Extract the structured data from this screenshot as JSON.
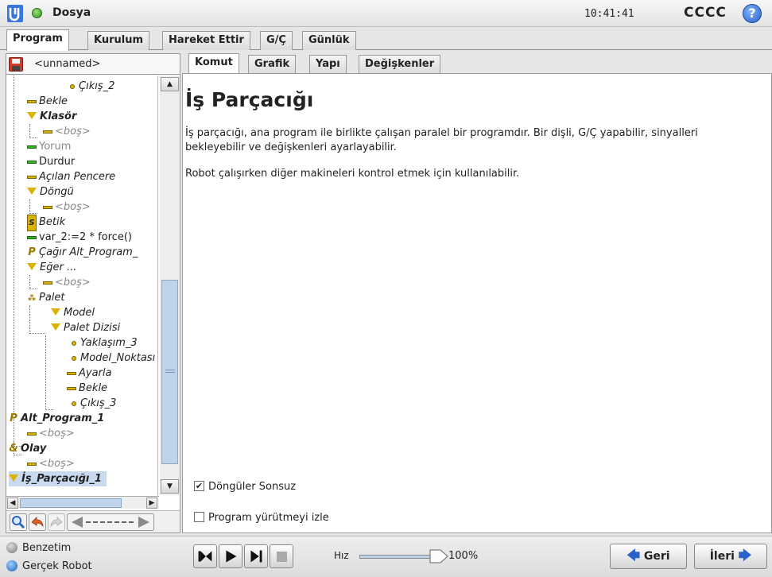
{
  "header": {
    "app_title": "Dosya",
    "clock": "10:41:41",
    "robot_name": "CCCC",
    "help_glyph": "?"
  },
  "main_tabs": [
    "Program",
    "Kurulum",
    "Hareket Ettir",
    "G/Ç",
    "Günlük"
  ],
  "active_main_tab": "Program",
  "file": {
    "name": "<unnamed>"
  },
  "tree": [
    {
      "label": "Çıkış_2",
      "icon": "waypoint-dot-icon",
      "style": "italic"
    },
    {
      "label": "Bekle",
      "icon": "command-bar-icon",
      "style": "italic"
    },
    {
      "label": "Klasör",
      "icon": "folder-triangle-icon",
      "style": "bold-italic"
    },
    {
      "label": "<boş>",
      "icon": "command-bar-icon",
      "style": "grey"
    },
    {
      "label": "Yorum",
      "icon": "comment-bar-icon",
      "style": "muted"
    },
    {
      "label": "Durdur",
      "icon": "halt-bar-icon",
      "style": "normal"
    },
    {
      "label": "Açılan Pencere",
      "icon": "command-bar-icon",
      "style": "italic"
    },
    {
      "label": "Döngü",
      "icon": "loop-triangle-icon",
      "style": "italic"
    },
    {
      "label": "<boş>",
      "icon": "command-bar-icon",
      "style": "grey"
    },
    {
      "label": "Betik",
      "icon": "script-icon",
      "style": "italic"
    },
    {
      "label": "var_2:=2 * force()",
      "icon": "assignment-bar-icon",
      "style": "normal"
    },
    {
      "label": "Çağır Alt_Program_",
      "icon": "call-subprogram-icon",
      "style": "italic"
    },
    {
      "label": "Eğer ...",
      "icon": "if-triangle-icon",
      "style": "italic"
    },
    {
      "label": "<boş>",
      "icon": "command-bar-icon",
      "style": "grey"
    },
    {
      "label": "Palet",
      "icon": "pallet-icon",
      "style": "italic"
    },
    {
      "label": "Model",
      "icon": "pattern-triangle-icon",
      "style": "italic"
    },
    {
      "label": "Palet Dizisi",
      "icon": "pallet-sequence-triangle-icon",
      "style": "italic"
    },
    {
      "label": "Yaklaşım_3",
      "icon": "waypoint-dot-icon",
      "style": "italic"
    },
    {
      "label": "Model_Noktası",
      "icon": "waypoint-dot-icon",
      "style": "italic"
    },
    {
      "label": "Ayarla",
      "icon": "command-bar-icon",
      "style": "italic"
    },
    {
      "label": "Bekle",
      "icon": "command-bar-icon",
      "style": "italic"
    },
    {
      "label": "Çıkış_3",
      "icon": "waypoint-dot-icon",
      "style": "italic"
    },
    {
      "label": "Alt_Program_1",
      "icon": "subprogram-icon",
      "style": "bold-italic"
    },
    {
      "label": "<boş>",
      "icon": "command-bar-icon",
      "style": "grey"
    },
    {
      "label": "Olay",
      "icon": "event-icon",
      "style": "bold-italic"
    },
    {
      "label": "<boş>",
      "icon": "command-bar-icon",
      "style": "grey"
    },
    {
      "label": "İş_Parçacığı_1",
      "icon": "thread-triangle-icon",
      "style": "bold-italic-selected"
    }
  ],
  "sub_tabs": [
    "Komut",
    "Grafik",
    "Yapı",
    "Değişkenler"
  ],
  "active_sub_tab": "Komut",
  "content": {
    "heading": "İş Parçacığı",
    "paragraph1": "İş parçacığı, ana program ile birlikte çalışan paralel bir programdır. Bir dişli, G/Ç yapabilir, sinyalleri bekleyebilir ve değişkenleri ayarlayabilir.",
    "paragraph2": "Robot çalışırken diğer makineleri kontrol etmek için kullanılabilir.",
    "checkbox_loop": {
      "label": "Döngüler Sonsuz",
      "checked": true
    },
    "checkbox_follow": {
      "label": "Program yürütmeyi izle",
      "checked": false
    }
  },
  "footer": {
    "mode_simulation": "Benzetim",
    "mode_real": "Gerçek Robot",
    "speed_label": "Hız",
    "speed_value": "100%",
    "speed_fraction": 1.0,
    "back_label": "Geri",
    "next_label": "İleri"
  }
}
